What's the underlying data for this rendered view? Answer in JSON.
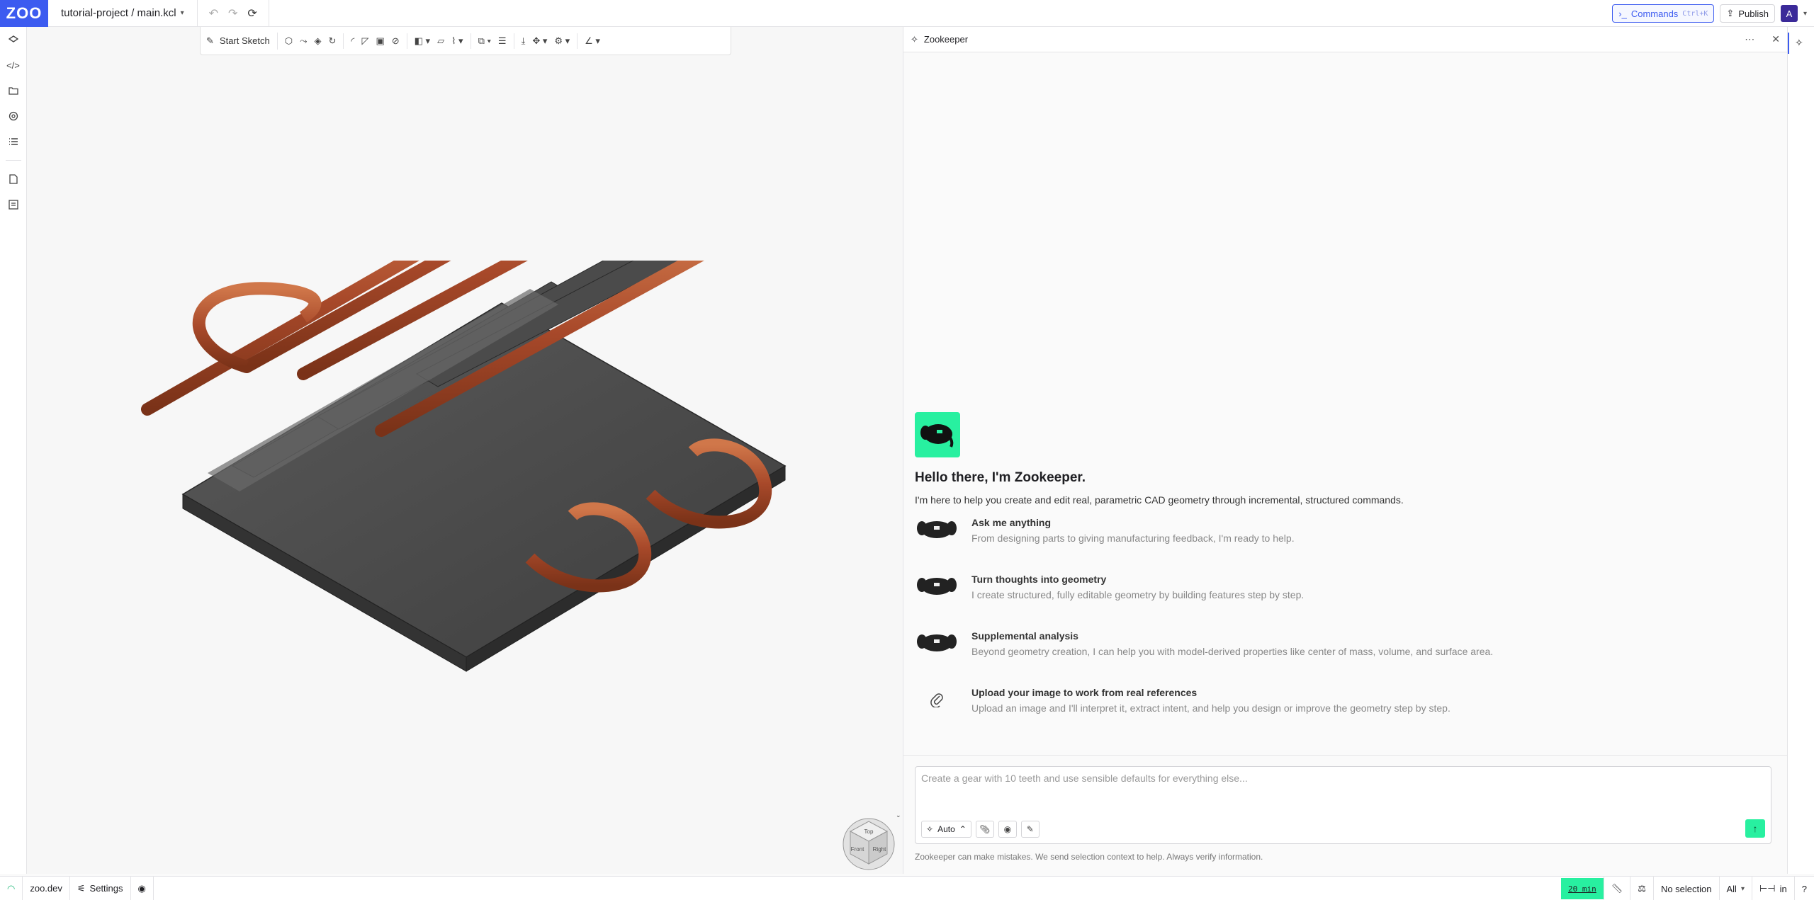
{
  "app": {
    "logo_text": "ZOO",
    "project_path": "tutorial-project / main.kcl"
  },
  "history": {
    "undo_icon": "undo-icon",
    "redo_icon": "redo-icon",
    "refresh_icon": "refresh-icon"
  },
  "header": {
    "commands_label": "Commands",
    "commands_shortcut": "Ctrl+K",
    "publish_label": "Publish",
    "avatar_initial": "A"
  },
  "toolbar": {
    "start_sketch_label": "Start Sketch"
  },
  "left_rail": {
    "items": [
      "feature-tree-icon",
      "code-icon",
      "files-icon",
      "settings-gear-icon",
      "list-icon",
      "document-icon",
      "log-icon"
    ]
  },
  "panel": {
    "title": "Zookeeper",
    "greeting": "Hello there, I'm Zookeeper.",
    "intro": "I'm here to help you create and edit real, parametric CAD geometry through incremental, structured commands.",
    "features": [
      {
        "title": "Ask me anything",
        "desc": "From designing parts to giving manufacturing feedback, I'm ready to help."
      },
      {
        "title": "Turn thoughts into geometry",
        "desc": "I create structured, fully editable geometry by building features step by step."
      },
      {
        "title": "Supplemental analysis",
        "desc": "Beyond geometry creation, I can help you with model-derived properties like center of mass, volume, and surface area."
      },
      {
        "title": "Upload your image to work from real references",
        "desc": "Upload an image and I'll interpret it, extract intent, and help you design or improve the geometry step by step."
      }
    ],
    "composer_placeholder": "Create a gear with 10 teeth and use sensible defaults for everything else...",
    "mode_label": "Auto",
    "disclaimer": "Zookeeper can make mistakes. We send selection context to help. Always verify information."
  },
  "navcube": {
    "top": "Top",
    "front": "Front",
    "right": "Right"
  },
  "status": {
    "host": "zoo.dev",
    "settings_label": "Settings",
    "timer": "20 min",
    "selection": "No selection",
    "filter": "All",
    "units": "in",
    "help": "?"
  },
  "colors": {
    "brand_blue": "#3c5bf0",
    "accent_green": "#28f0a0",
    "copper": "#b5532a",
    "plate": "#4a4a4a"
  }
}
